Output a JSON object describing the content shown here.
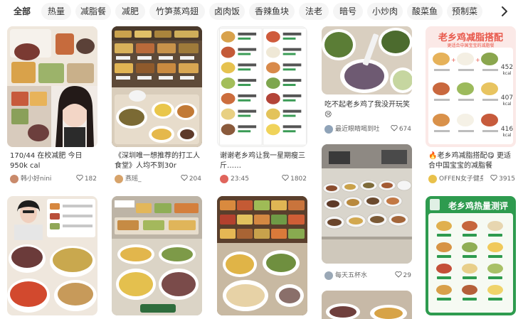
{
  "tabs": [
    {
      "label": "全部",
      "active": true
    },
    {
      "label": "热量"
    },
    {
      "label": "减脂餐"
    },
    {
      "label": "减肥"
    },
    {
      "label": "竹笋蒸鸡翅"
    },
    {
      "label": "卤肉饭"
    },
    {
      "label": "香辣鱼块"
    },
    {
      "label": "法老"
    },
    {
      "label": "暗号"
    },
    {
      "label": "小炒肉"
    },
    {
      "label": "酸菜鱼"
    },
    {
      "label": "预制菜"
    }
  ],
  "more_icon": "chevron-right-icon",
  "notes": [
    {
      "title": "170/44 在校减肥 今日950k cal",
      "author": "韩小好nini",
      "likes": "182",
      "avatar_color": "#c98a6b",
      "cover": {
        "scene": "photo-grid",
        "bg": "#e7ded3"
      }
    },
    {
      "title": "吃不起老乡鸡了我没开玩笑😢",
      "author": "最近眼睛喝到吐",
      "likes": "674",
      "avatar_color": "#8fa3b8",
      "cover": {
        "scene": "bowls",
        "bg": "#d9cfc0"
      }
    },
    {
      "title": "",
      "author": "",
      "likes": "29",
      "avatar_color": "#a0a0a0",
      "cover": {
        "scene": "canteen",
        "bg": "#b9b5ad"
      }
    },
    {
      "title": "《深圳唯一想推荐的打工人食堂》人均不到30r",
      "author": "燕瑶_",
      "likes": "204",
      "avatar_color": "#d7a36a",
      "cover": {
        "scene": "buffet",
        "bg": "#6e5a44"
      }
    },
    {
      "title": "谢谢老乡鸡让我一星期瘦三斤……",
      "author": "23:45",
      "likes": "1802",
      "avatar_color": "#e0655c",
      "cover": {
        "scene": "menu",
        "bg": "#f4f4f2"
      }
    },
    {
      "title": "🔥老乡鸡减脂搭配😋 更适合中国宝宝的减脂餐",
      "author": "OFFEN女子健身",
      "likes": "3915",
      "avatar_color": "#e9c14b",
      "cover": {
        "scene": "poster",
        "bg": "#fbe9e7"
      }
    },
    {
      "title": "",
      "author": "",
      "likes": "",
      "avatar_color": "#cccccc",
      "cover": {
        "scene": "bowls",
        "bg": "#efe7dd"
      }
    },
    {
      "title": "",
      "author": "",
      "likes": "",
      "avatar_color": "#cccccc",
      "cover": {
        "scene": "buffet",
        "bg": "#c8c1b4"
      }
    },
    {
      "title": "",
      "author": "",
      "likes": "",
      "avatar_color": "#cccccc",
      "cover": {
        "scene": "buffet",
        "bg": "#6b4e36"
      }
    },
    {
      "title": "",
      "author": "",
      "likes": "",
      "avatar_color": "#cccccc",
      "cover": {
        "scene": "canteen",
        "bg": "#c7b9a7"
      }
    },
    {
      "title": "",
      "author": "",
      "likes": "",
      "avatar_color": "#cccccc",
      "cover": {
        "scene": "poster-green",
        "bg": "#f3f7f1"
      }
    }
  ],
  "poster": {
    "headline": "老乡鸡减脂搭配",
    "subline": "更适合中国宝宝的减脂餐",
    "kcal": [
      "452",
      "407",
      "416"
    ],
    "kcal_unit": "kcal"
  },
  "poster_green": {
    "headline": "老乡鸡热量测评"
  },
  "colors": {
    "tab_bg": "#f5f5f5",
    "text": "#333333",
    "meta": "#666666",
    "poster_red": "#e8584b",
    "poster_green": "#2e9b4f"
  }
}
